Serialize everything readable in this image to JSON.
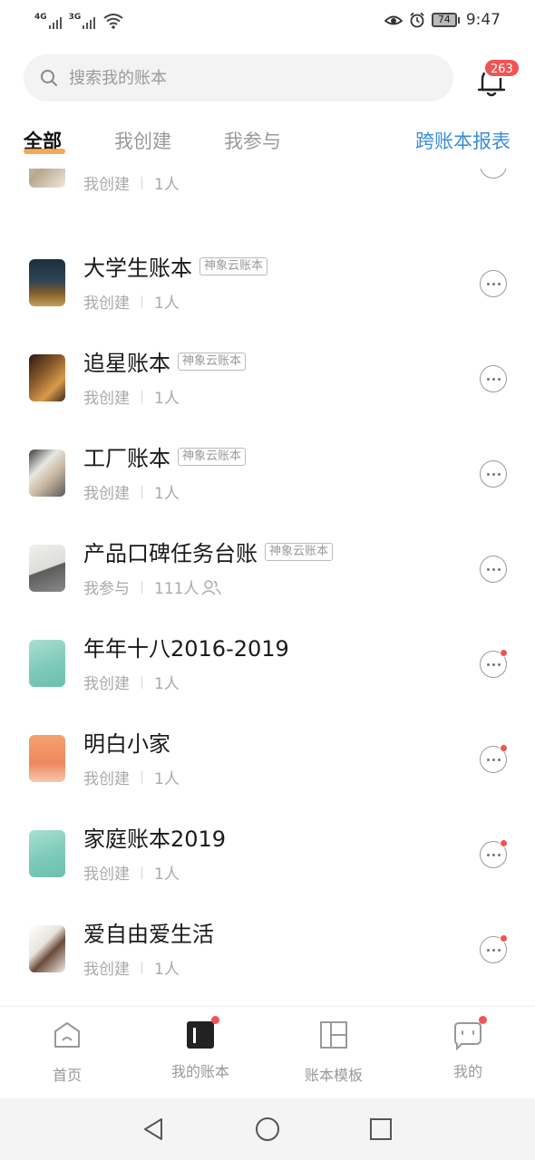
{
  "status_bar": {
    "network1": "4G",
    "network2": "3G",
    "battery": "74",
    "time": "9:47"
  },
  "search": {
    "placeholder": "搜索我的账本"
  },
  "notifications": {
    "count": "263"
  },
  "tabs": [
    {
      "label": "全部",
      "active": true
    },
    {
      "label": "我创建",
      "active": false
    },
    {
      "label": "我参与",
      "active": false
    }
  ],
  "cross_report_label": "跨账本报表",
  "books": [
    {
      "title": "",
      "tag": "",
      "role": "我创建",
      "members": "1人",
      "has_dot": false,
      "thumb": "photo-partial"
    },
    {
      "title": "大学生账本",
      "tag": "神象云账本",
      "role": "我创建",
      "members": "1人",
      "has_dot": false,
      "thumb": "photo-books"
    },
    {
      "title": "追星账本",
      "tag": "神象云账本",
      "role": "我创建",
      "members": "1人",
      "has_dot": false,
      "thumb": "photo-concert"
    },
    {
      "title": "工厂账本",
      "tag": "神象云账本",
      "role": "我创建",
      "members": "1人",
      "has_dot": false,
      "thumb": "photo-factory"
    },
    {
      "title": "产品口碑任务台账",
      "tag": "神象云账本",
      "role": "我参与",
      "members": "111人",
      "has_dot": false,
      "thumb": "photo-building"
    },
    {
      "title": "年年十八2016-2019",
      "tag": "",
      "role": "我创建",
      "members": "1人",
      "has_dot": true,
      "thumb": "mint"
    },
    {
      "title": "明白小家",
      "tag": "",
      "role": "我创建",
      "members": "1人",
      "has_dot": true,
      "thumb": "orange-couple"
    },
    {
      "title": "家庭账本2019",
      "tag": "",
      "role": "我创建",
      "members": "1人",
      "has_dot": true,
      "thumb": "mint"
    },
    {
      "title": "爱自由爱生活",
      "tag": "",
      "role": "我创建",
      "members": "1人",
      "has_dot": true,
      "thumb": "cartoon-family"
    }
  ],
  "bottom_nav": [
    {
      "label": "首页",
      "icon": "home-icon",
      "active": false
    },
    {
      "label": "我的账本",
      "icon": "ledger-icon",
      "active": true
    },
    {
      "label": "账本模板",
      "icon": "template-icon",
      "active": false
    },
    {
      "label": "我的",
      "icon": "profile-icon",
      "active": false
    }
  ],
  "colors": {
    "accent_blue": "#3a8ed8",
    "badge_red": "#f05454",
    "tab_underline": "#f29a3c"
  }
}
